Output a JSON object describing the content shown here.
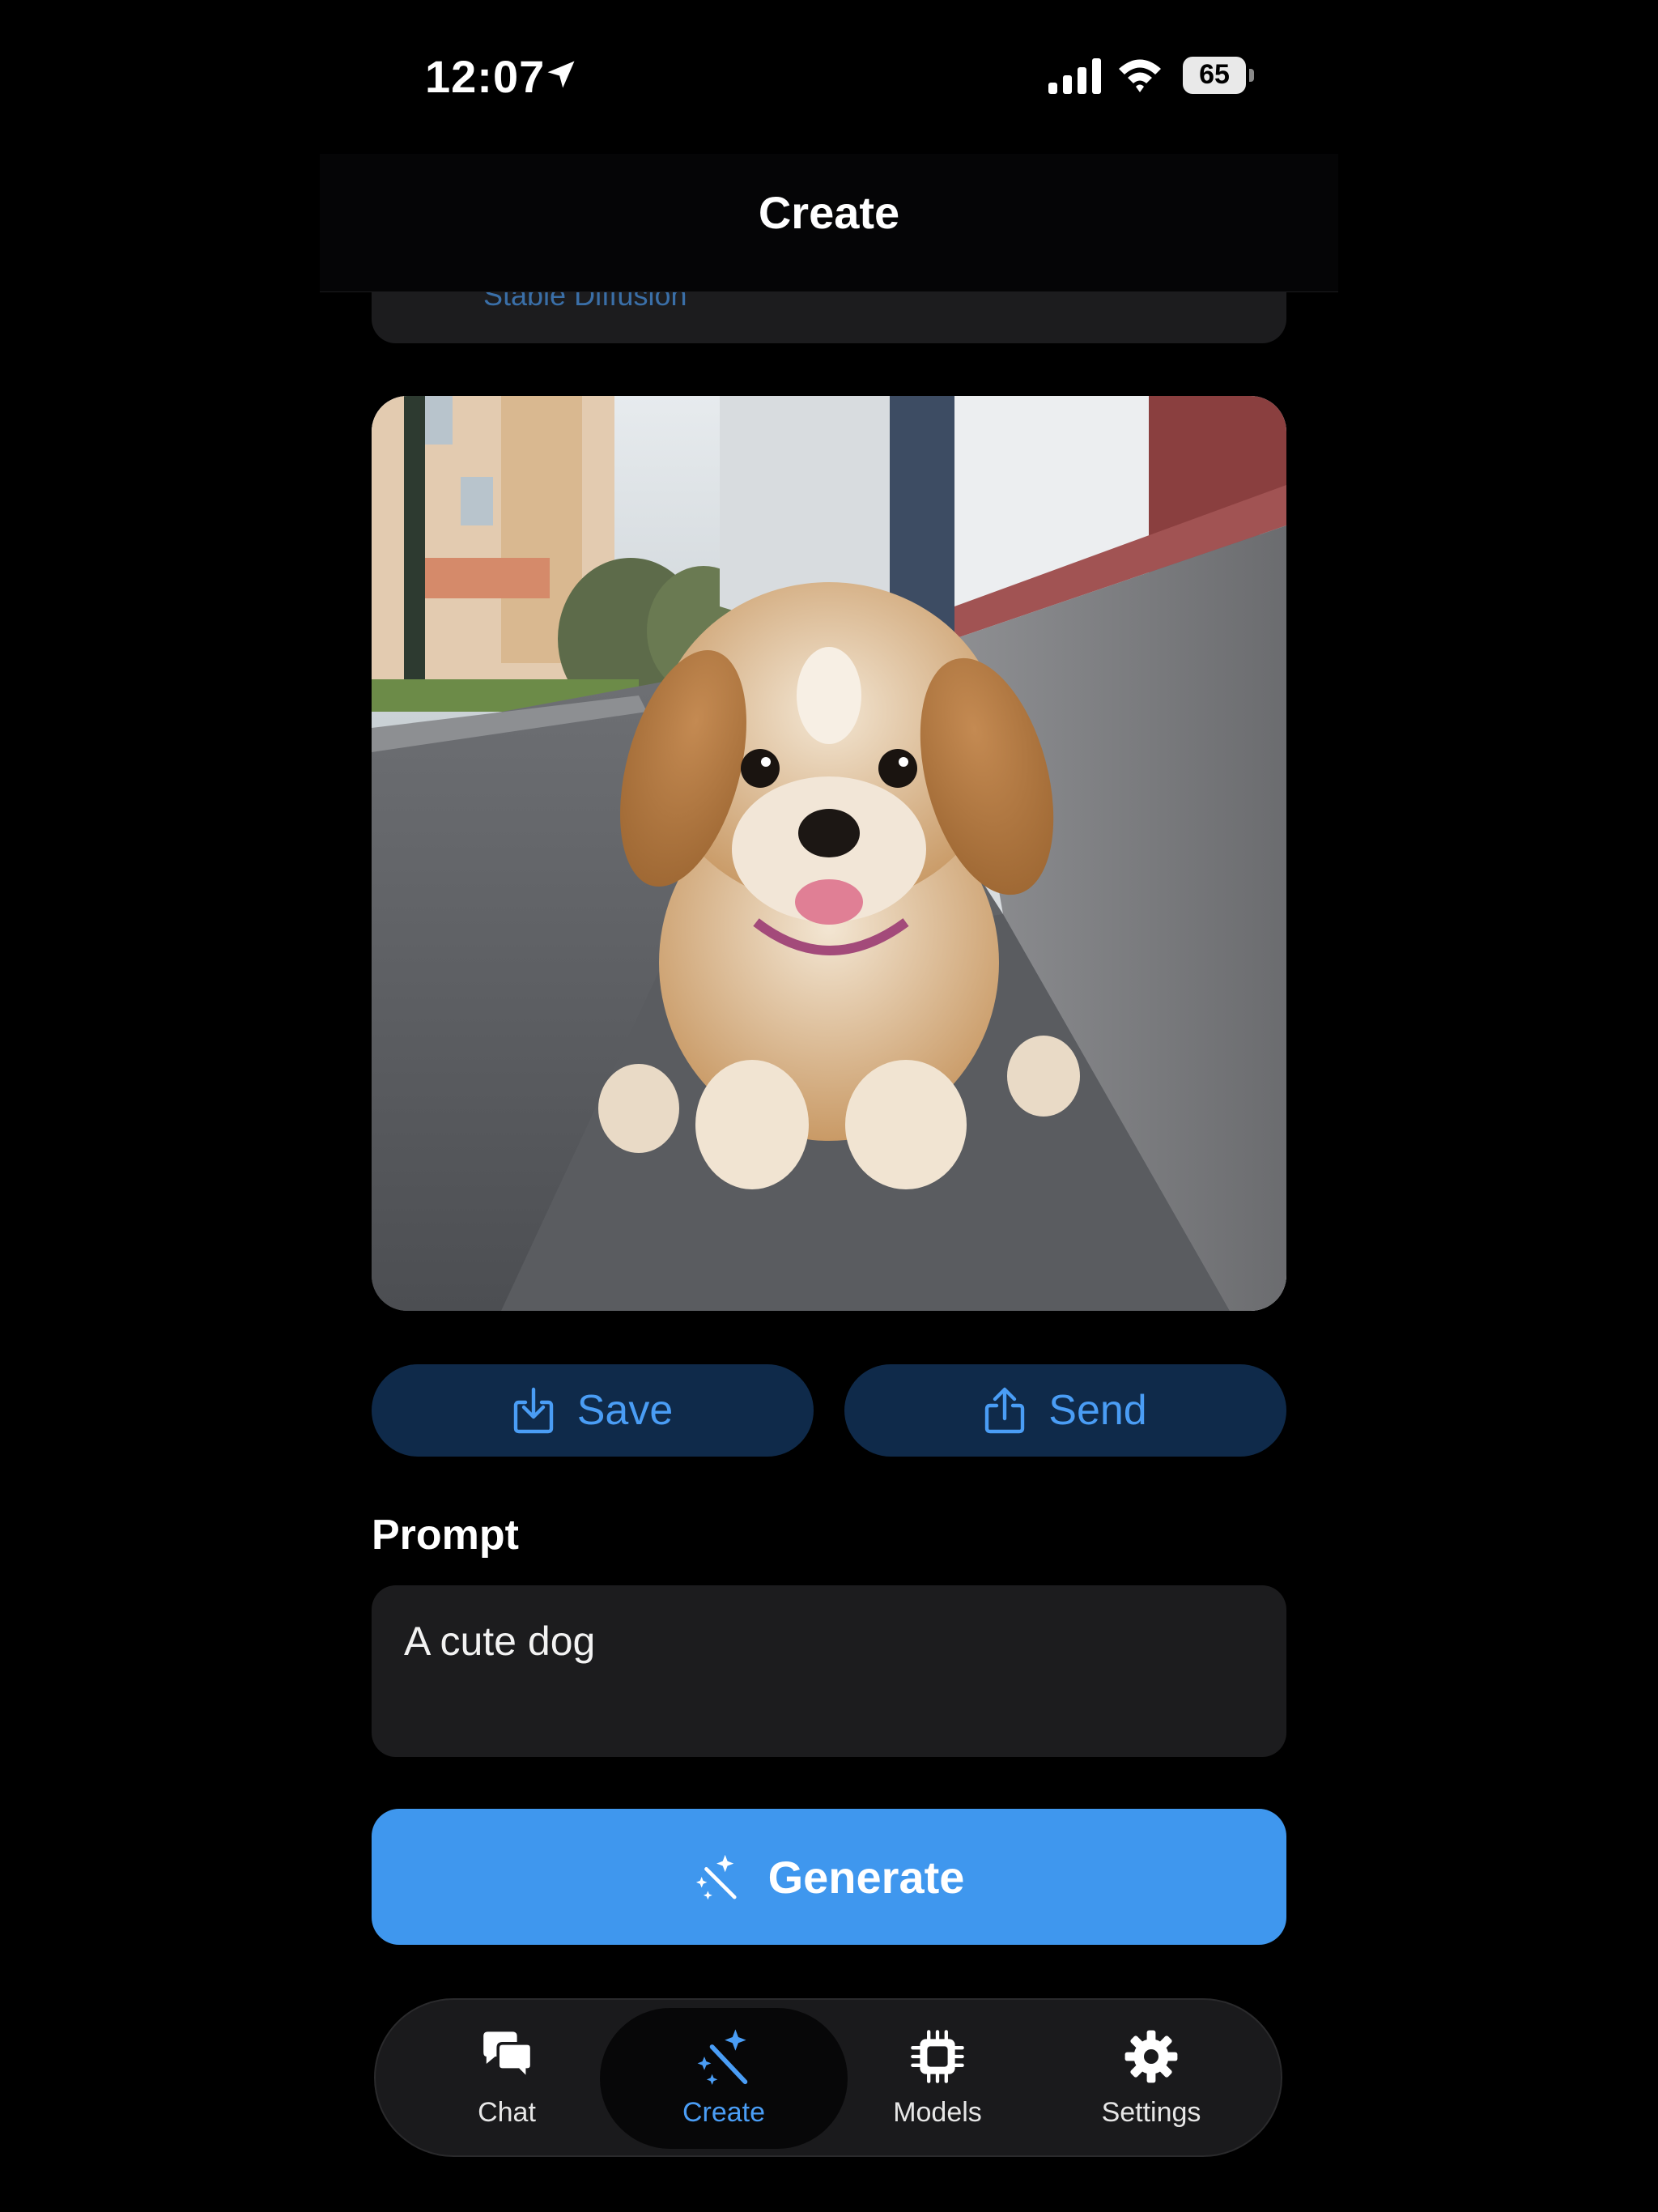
{
  "status_bar": {
    "time": "12:07",
    "battery_percent": "65",
    "icons": [
      "location-arrow-icon",
      "cellular-signal-icon",
      "wifi-icon",
      "battery-icon"
    ]
  },
  "header": {
    "title": "Create"
  },
  "model_card": {
    "subtitle": "Stable Diffusion"
  },
  "image": {
    "subject": "generated-dog-image"
  },
  "actions": {
    "save_label": "Save",
    "send_label": "Send"
  },
  "prompt": {
    "label": "Prompt",
    "value": "A cute dog"
  },
  "generate": {
    "label": "Generate"
  },
  "tabs": [
    {
      "label": "Chat",
      "icon": "chat-bubbles-icon",
      "active": false
    },
    {
      "label": "Create",
      "icon": "magic-wand-icon",
      "active": true
    },
    {
      "label": "Models",
      "icon": "chip-icon",
      "active": false
    },
    {
      "label": "Settings",
      "icon": "gear-icon",
      "active": false
    }
  ],
  "colors": {
    "accent": "#3f97ee",
    "accent_text": "#4a9df5",
    "button_dark": "#0f2a4a",
    "background": "#000000",
    "card": "#1c1c1e"
  }
}
